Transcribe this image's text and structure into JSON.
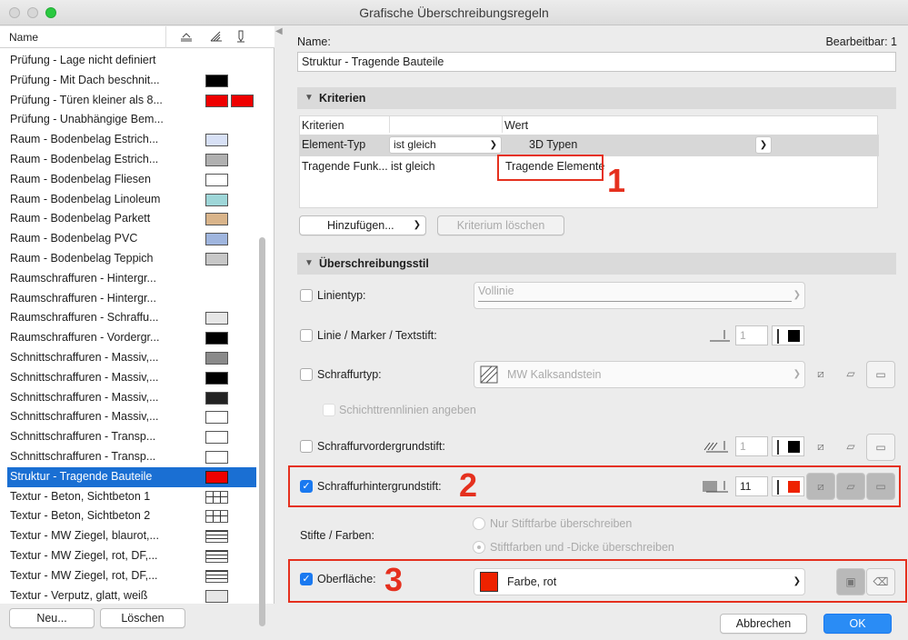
{
  "window": {
    "title": "Grafische Überschreibungsregeln"
  },
  "list": {
    "header_name": "Name",
    "header_icons": [
      "level-icon",
      "hatch-icon",
      "pen-icon"
    ],
    "items": [
      {
        "label": "Prüfung - Lage nicht definiert",
        "swatch": []
      },
      {
        "label": "Prüfung - Mit Dach beschnit...",
        "swatch": [
          "#000000"
        ]
      },
      {
        "label": "Prüfung - Türen kleiner als 8...",
        "swatch": [
          "#ee0000",
          "#ee0000"
        ]
      },
      {
        "label": "Prüfung - Unabhängige Bem...",
        "swatch": []
      },
      {
        "label": "Raum - Bodenbelag Estrich...",
        "swatch": [
          "#d7e0f5"
        ]
      },
      {
        "label": "Raum - Bodenbelag Estrich...",
        "swatch": [
          "#b0b0b0"
        ]
      },
      {
        "label": "Raum - Bodenbelag Fliesen",
        "swatch": [
          "#ffffff"
        ]
      },
      {
        "label": "Raum - Bodenbelag Linoleum",
        "swatch": [
          "#9ed6d8"
        ]
      },
      {
        "label": "Raum - Bodenbelag Parkett",
        "swatch": [
          "#d9b48a"
        ]
      },
      {
        "label": "Raum - Bodenbelag PVC",
        "swatch": [
          "#9fb5de"
        ]
      },
      {
        "label": "Raum - Bodenbelag Teppich",
        "swatch": [
          "#c7c7c7"
        ]
      },
      {
        "label": "Raumschraffuren - Hintergr...",
        "swatch": []
      },
      {
        "label": "Raumschraffuren - Hintergr...",
        "swatch": []
      },
      {
        "label": "Raumschraffuren - Schraffu...",
        "swatch": [
          "#e6e6e6"
        ]
      },
      {
        "label": "Raumschraffuren - Vordergr...",
        "swatch": [
          "#000000"
        ]
      },
      {
        "label": "Schnittschraffuren - Massiv,...",
        "swatch": [
          "#8a8a8a"
        ]
      },
      {
        "label": "Schnittschraffuren - Massiv,...",
        "swatch": [
          "#000000"
        ]
      },
      {
        "label": "Schnittschraffuren - Massiv,...",
        "swatch": [
          "#222222"
        ]
      },
      {
        "label": "Schnittschraffuren - Massiv,...",
        "swatch": [
          "#ffffff"
        ]
      },
      {
        "label": "Schnittschraffuren - Transp...",
        "swatch": [
          "#ffffff"
        ]
      },
      {
        "label": "Schnittschraffuren - Transp...",
        "swatch": [
          "#ffffff"
        ]
      },
      {
        "label": "Struktur - Tragende Bauteile",
        "swatch": [
          "#ee0000"
        ],
        "selected": true
      },
      {
        "label": "Textur - Beton, Sichtbeton 1",
        "swatch": [
          "grid"
        ]
      },
      {
        "label": "Textur - Beton, Sichtbeton 2",
        "swatch": [
          "grid"
        ]
      },
      {
        "label": "Textur - MW Ziegel, blaurot,...",
        "swatch": [
          "brick"
        ]
      },
      {
        "label": "Textur - MW Ziegel, rot, DF,...",
        "swatch": [
          "brick"
        ]
      },
      {
        "label": "Textur - MW Ziegel, rot, DF,...",
        "swatch": [
          "brick"
        ]
      },
      {
        "label": "Textur - Verputz, glatt, weiß",
        "swatch": [
          "#e6e6e6"
        ]
      }
    ],
    "new_button": "Neu...",
    "delete_button": "Löschen"
  },
  "detail": {
    "name_label": "Name:",
    "editable": "Bearbeitbar: 1",
    "name_value": "Struktur - Tragende Bauteile",
    "criteria_section": "Kriterien",
    "criteria_cols": [
      "Kriterien",
      "Wert"
    ],
    "criteria_rows": [
      {
        "criterion": "Element-Typ",
        "operator": "ist gleich",
        "value": "3D Typen"
      },
      {
        "criterion": "Tragende Funk...",
        "operator": "ist gleich",
        "value": "Tragende Elemente"
      }
    ],
    "add_button": "Hinzufügen...",
    "delete_criterion_button": "Kriterium löschen",
    "style_section": "Überschreibungsstil",
    "linetype_label": "Linientyp:",
    "linetype_value": "Vollinie",
    "line_pen_label": "Linie / Marker / Textstift:",
    "line_pen_value": "1",
    "hatch_label": "Schraffurtyp:",
    "hatch_value": "MW Kalksandstein",
    "layer_lines_label": "Schichttrennlinien angeben",
    "fg_pen_label": "Schraffurvordergrundstift:",
    "fg_pen_value": "1",
    "bg_pen_label": "Schraffurhintergrundstift:",
    "bg_pen_value": "11",
    "pens_colors_label": "Stifte / Farben:",
    "radio_1": "Nur Stiftfarbe überschreiben",
    "radio_2": "Stiftfarben und -Dicke überschreiben",
    "surface_label": "Oberfläche:",
    "surface_value": "Farbe, rot",
    "cancel_button": "Abbrechen",
    "ok_button": "OK",
    "annotations": [
      "1",
      "2",
      "3"
    ]
  },
  "colors": {
    "accent": "#1a79f0",
    "highlight": "#e5301e",
    "selection": "#1a6fd3"
  }
}
